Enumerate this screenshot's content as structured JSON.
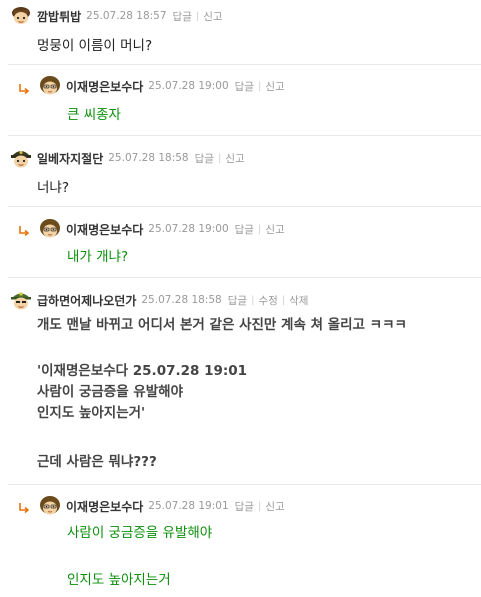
{
  "comments": [
    {
      "nick": "깜밥튀밥",
      "date": "25.07.28 18:57",
      "reply_label": "답글",
      "report_label": "신고",
      "text": "멍뭉이 이름이 머니?"
    },
    {
      "nick": "이재명은보수다",
      "date": "25.07.28 19:00",
      "reply_label": "답글",
      "report_label": "신고",
      "text": "큰 씨종자"
    },
    {
      "nick": "일베자지절단",
      "date": "25.07.28 18:58",
      "reply_label": "답글",
      "report_label": "신고",
      "text": "너냐?"
    },
    {
      "nick": "이재명은보수다",
      "date": "25.07.28 19:00",
      "reply_label": "답글",
      "report_label": "신고",
      "text": "내가 개냐?"
    },
    {
      "nick": "급하면어제나오던가",
      "date": "25.07.28 18:58",
      "reply_label": "답글",
      "edit_label": "수정",
      "delete_label": "삭제",
      "lines": [
        "개도 맨날 바뀌고 어디서 본거 같은 사진만 계속 쳐 올리고 ㅋㅋㅋ",
        "'이재명은보수다 25.07.28 19:01",
        "사람이 궁금증을 유발해야",
        "인지도 높아지는거'",
        "근데 사람은 뭐냐???"
      ]
    },
    {
      "nick": "이재명은보수다",
      "date": "25.07.28 19:01",
      "reply_label": "답글",
      "report_label": "신고",
      "lines": [
        "사람이 궁금증을 유발해야",
        "인지도 높아지는거"
      ]
    }
  ],
  "colors": {
    "reply_text": "#0b8f0b",
    "reply_arrow": "#e8740c",
    "meta": "#999999",
    "divider": "#e8e8e8"
  },
  "icons": {
    "reply_arrow": "reply-arrow-icon",
    "avatar": "character-avatar-icon"
  }
}
